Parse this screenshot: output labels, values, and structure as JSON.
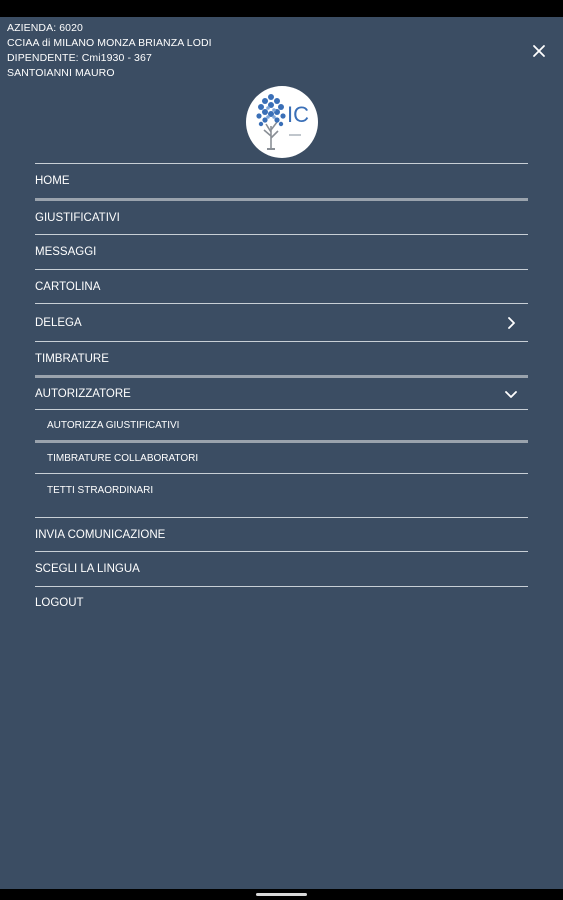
{
  "header": {
    "azienda": "AZIENDA: 6020",
    "ente": "CCIAA di MILANO MONZA BRIANZA LODI",
    "dipendente": "DIPENDENTE: Cmi1930 - 367",
    "nome": "SANTOIANNI MAURO"
  },
  "logo": {
    "letters": "IC",
    "icon": "tree-logo"
  },
  "close_icon": "close-icon",
  "menu": {
    "home": "HOME",
    "giustificativi": "GIUSTIFICATIVI",
    "messaggi": "MESSAGGI",
    "cartolina": "CARTOLINA",
    "delega": "DELEGA",
    "timbrature": "TIMBRATURE",
    "autorizzatore": "AUTORIZZATORE",
    "autorizza_giustificativi": "AUTORIZZA GIUSTIFICATIVI",
    "timbrature_collaboratori": "TIMBRATURE COLLABORATORI",
    "tetti_straordinari": "TETTI STRAORDINARI",
    "invia_comunicazione": "INVIA COMUNICAZIONE",
    "scegli_lingua": "SCEGLI LA LINGUA",
    "logout": "LOGOUT"
  },
  "colors": {
    "background": "#3b4d63",
    "text": "#ffffff",
    "separator": "#c8cfd6",
    "logo_blue": "#3a6fb7"
  }
}
